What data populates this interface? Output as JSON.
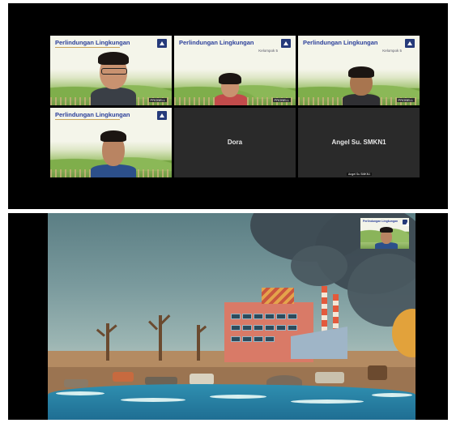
{
  "meeting": {
    "tiles": [
      {
        "title": "Perlindungan Lingkungan",
        "subtitle": "",
        "participant": "",
        "tag": "PROBELL"
      },
      {
        "title": "Perlindungan Lingkungan",
        "subtitle": "Kelompok 5",
        "participant": "",
        "tag": "PROBELL"
      },
      {
        "title": "Perlindungan Lingkungan",
        "subtitle": "Kelompok 5",
        "participant": "",
        "tag": "PROBELL"
      },
      {
        "title": "Perlindungan Lingkungan",
        "subtitle": "",
        "participant": "",
        "tag": ""
      }
    ],
    "video_off": [
      {
        "name": "Dora"
      },
      {
        "name": "Angel Su. SMKN1"
      }
    ],
    "small_caption": "Angel Su SMKN1"
  },
  "presentation": {
    "pip_title": "Perlindungan Lingkungan"
  },
  "colors": {
    "title_blue": "#2b3f9a",
    "meeting_bg": "#000000",
    "sky": "#7a9a9d",
    "water": "#2f8fb0"
  },
  "icons": [
    "logo-icon"
  ]
}
